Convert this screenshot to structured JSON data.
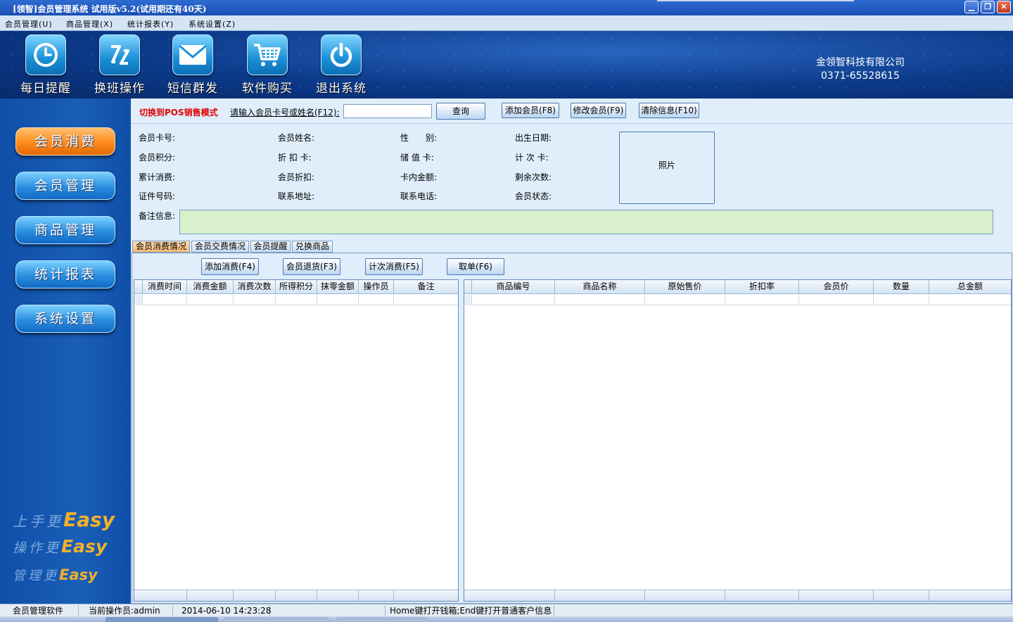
{
  "window": {
    "title": "[领智]会员管理系统 试用版v5.2(试用期还有40天)",
    "controls": [
      "minimize",
      "restore",
      "close"
    ]
  },
  "menubar": {
    "items": [
      {
        "label": "会员管理(U)"
      },
      {
        "label": "商品管理(X)"
      },
      {
        "label": "统计报表(Y)"
      },
      {
        "label": "系统设置(Z)"
      }
    ]
  },
  "toolbar": {
    "buttons": [
      {
        "label": "每日提醒",
        "icon": "clock-icon"
      },
      {
        "label": "换班操作",
        "icon": "shift-swap-icon"
      },
      {
        "label": "短信群发",
        "icon": "envelope-icon"
      },
      {
        "label": "软件购买",
        "icon": "shopping-cart-icon"
      },
      {
        "label": "退出系统",
        "icon": "power-icon"
      }
    ],
    "company_name": "金领智科技有限公司",
    "company_phone": "0371-65528615"
  },
  "sidebar": {
    "items": [
      {
        "label": "会员消费",
        "active": true
      },
      {
        "label": "会员管理",
        "active": false
      },
      {
        "label": "商品管理",
        "active": false
      },
      {
        "label": "统计报表",
        "active": false
      },
      {
        "label": "系统设置",
        "active": false
      }
    ],
    "slogans": [
      {
        "prefix": "上手更",
        "easy": "Easy"
      },
      {
        "prefix": "操作更",
        "easy": "Easy"
      },
      {
        "prefix": "管理更",
        "easy": "Easy"
      }
    ]
  },
  "search": {
    "pos_mode_link": "切换到POS销售模式",
    "label": "请输入会员卡号或姓名(F12):",
    "value": "",
    "query_button": "查询",
    "add_member_button": "添加会员(F8)",
    "edit_member_button": "修改会员(F9)",
    "clear_info_button": "清除信息(F10)"
  },
  "member_info": {
    "card_no": "会员卡号:",
    "name": "会员姓名:",
    "gender": "性　　别:",
    "birthday": "出生日期:",
    "points": "会员积分:",
    "discount_card": "折 扣 卡:",
    "stored_value_card": "储 值 卡:",
    "count_card": "计 次 卡:",
    "total_spent": "累计消费:",
    "member_discount": "会员折扣:",
    "card_balance": "卡内金额:",
    "remaining_count": "剩余次数:",
    "id_number": "证件号码:",
    "address": "联系地址:",
    "phone": "联系电话:",
    "status": "会员状态:",
    "photo_label": "照片",
    "remark_label": "备注信息:",
    "remark_value": ""
  },
  "tabs": [
    {
      "label": "会员消费情况",
      "active": true
    },
    {
      "label": "会员交费情况",
      "active": false
    },
    {
      "label": "会员提醒",
      "active": false
    },
    {
      "label": "兑换商品",
      "active": false
    }
  ],
  "actions": {
    "add_consumption": "添加消费(F4)",
    "member_return": "会员退货(F3)",
    "count_consumption": "计次消费(F5)",
    "cancel_order": "取单(F6)"
  },
  "consumption_table": {
    "columns": [
      "消费时间",
      "消费金额",
      "消费次数",
      "所得积分",
      "抹零金额",
      "操作员",
      "备注"
    ],
    "rows": []
  },
  "goods_table": {
    "columns": [
      "商品编号",
      "商品名称",
      "原始售价",
      "折扣率",
      "会员价",
      "数量",
      "总金额"
    ],
    "rows": []
  },
  "statusbar": {
    "app_name": "会员管理软件",
    "operator": "当前操作员:admin",
    "datetime": "2014-06-10 14:23:28",
    "hint": "Home键打开钱箱;End键打开普通客户信息"
  },
  "colors": {
    "title_bar": "#1a4fb4",
    "header_bg": "#0c3a8a",
    "sidebar_bg": "#1a5eb8",
    "active_nav": "#ff8a1c",
    "pos_link": "#e00000",
    "remark_bg": "#d8f0cc",
    "main_bg": "#dfeefa"
  }
}
